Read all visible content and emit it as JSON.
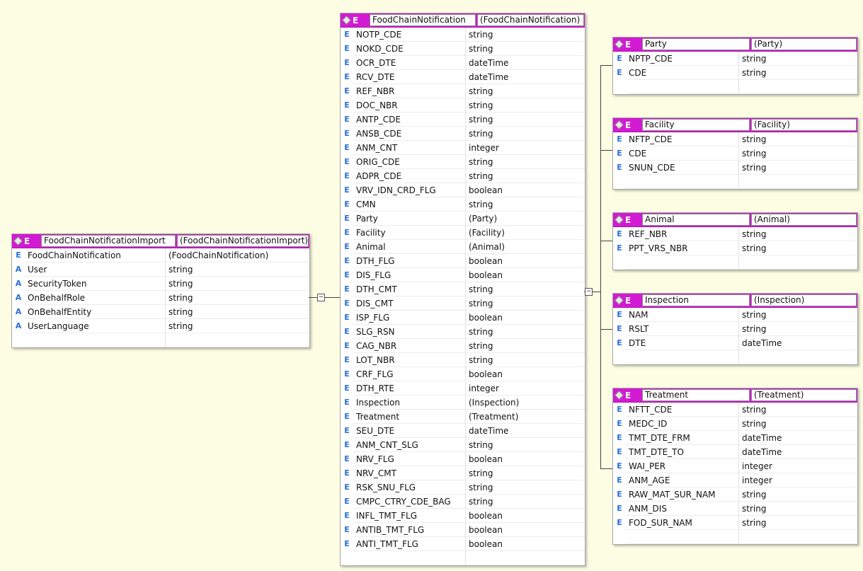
{
  "tables": [
    {
      "id": "import",
      "name": "FoodChainNotificationImport",
      "type": "(FoodChainNotificationImport)",
      "rows": [
        {
          "kind": "E",
          "name": "FoodChainNotification",
          "type": "(FoodChainNotification)"
        },
        {
          "kind": "A",
          "name": "User",
          "type": "string"
        },
        {
          "kind": "A",
          "name": "SecurityToken",
          "type": "string"
        },
        {
          "kind": "A",
          "name": "OnBehalfRole",
          "type": "string"
        },
        {
          "kind": "A",
          "name": "OnBehalfEntity",
          "type": "string"
        },
        {
          "kind": "A",
          "name": "UserLanguage",
          "type": "string"
        }
      ]
    },
    {
      "id": "notification",
      "name": "FoodChainNotification",
      "type": "(FoodChainNotification)",
      "rows": [
        {
          "kind": "E",
          "name": "NOTP_CDE",
          "type": "string"
        },
        {
          "kind": "E",
          "name": "NOKD_CDE",
          "type": "string"
        },
        {
          "kind": "E",
          "name": "OCR_DTE",
          "type": "dateTime"
        },
        {
          "kind": "E",
          "name": "RCV_DTE",
          "type": "dateTime"
        },
        {
          "kind": "E",
          "name": "REF_NBR",
          "type": "string"
        },
        {
          "kind": "E",
          "name": "DOC_NBR",
          "type": "string"
        },
        {
          "kind": "E",
          "name": "ANTP_CDE",
          "type": "string"
        },
        {
          "kind": "E",
          "name": "ANSB_CDE",
          "type": "string"
        },
        {
          "kind": "E",
          "name": "ANM_CNT",
          "type": "integer"
        },
        {
          "kind": "E",
          "name": "ORIG_CDE",
          "type": "string"
        },
        {
          "kind": "E",
          "name": "ADPR_CDE",
          "type": "string"
        },
        {
          "kind": "E",
          "name": "VRV_IDN_CRD_FLG",
          "type": "boolean"
        },
        {
          "kind": "E",
          "name": "CMN",
          "type": "string"
        },
        {
          "kind": "E",
          "name": "Party",
          "type": "(Party)"
        },
        {
          "kind": "E",
          "name": "Facility",
          "type": "(Facility)"
        },
        {
          "kind": "E",
          "name": "Animal",
          "type": "(Animal)"
        },
        {
          "kind": "E",
          "name": "DTH_FLG",
          "type": "boolean"
        },
        {
          "kind": "E",
          "name": "DIS_FLG",
          "type": "boolean"
        },
        {
          "kind": "E",
          "name": "DTH_CMT",
          "type": "string"
        },
        {
          "kind": "E",
          "name": "DIS_CMT",
          "type": "string"
        },
        {
          "kind": "E",
          "name": "ISP_FLG",
          "type": "boolean"
        },
        {
          "kind": "E",
          "name": "SLG_RSN",
          "type": "string"
        },
        {
          "kind": "E",
          "name": "CAG_NBR",
          "type": "string"
        },
        {
          "kind": "E",
          "name": "LOT_NBR",
          "type": "string"
        },
        {
          "kind": "E",
          "name": "CRF_FLG",
          "type": "boolean"
        },
        {
          "kind": "E",
          "name": "DTH_RTE",
          "type": "integer"
        },
        {
          "kind": "E",
          "name": "Inspection",
          "type": "(Inspection)"
        },
        {
          "kind": "E",
          "name": "Treatment",
          "type": "(Treatment)"
        },
        {
          "kind": "E",
          "name": "SEU_DTE",
          "type": "dateTime"
        },
        {
          "kind": "E",
          "name": "ANM_CNT_SLG",
          "type": "string"
        },
        {
          "kind": "E",
          "name": "NRV_FLG",
          "type": "boolean"
        },
        {
          "kind": "E",
          "name": "NRV_CMT",
          "type": "string"
        },
        {
          "kind": "E",
          "name": "RSK_SNU_FLG",
          "type": "string"
        },
        {
          "kind": "E",
          "name": "CMPC_CTRY_CDE_BAG",
          "type": "string"
        },
        {
          "kind": "E",
          "name": "INFL_TMT_FLG",
          "type": "boolean"
        },
        {
          "kind": "E",
          "name": "ANTIB_TMT_FLG",
          "type": "boolean"
        },
        {
          "kind": "E",
          "name": "ANTI_TMT_FLG",
          "type": "boolean"
        }
      ]
    },
    {
      "id": "party",
      "name": "Party",
      "type": "(Party)",
      "rows": [
        {
          "kind": "E",
          "name": "NPTP_CDE",
          "type": "string"
        },
        {
          "kind": "E",
          "name": "CDE",
          "type": "string"
        }
      ]
    },
    {
      "id": "facility",
      "name": "Facility",
      "type": "(Facility)",
      "rows": [
        {
          "kind": "E",
          "name": "NFTP_CDE",
          "type": "string"
        },
        {
          "kind": "E",
          "name": "CDE",
          "type": "string"
        },
        {
          "kind": "E",
          "name": "SNUN_CDE",
          "type": "string"
        }
      ]
    },
    {
      "id": "animal",
      "name": "Animal",
      "type": "(Animal)",
      "rows": [
        {
          "kind": "E",
          "name": "REF_NBR",
          "type": "string"
        },
        {
          "kind": "E",
          "name": "PPT_VRS_NBR",
          "type": "string"
        }
      ]
    },
    {
      "id": "inspection",
      "name": "Inspection",
      "type": "(Inspection)",
      "rows": [
        {
          "kind": "E",
          "name": "NAM",
          "type": "string"
        },
        {
          "kind": "E",
          "name": "RSLT",
          "type": "string"
        },
        {
          "kind": "E",
          "name": "DTE",
          "type": "dateTime"
        }
      ]
    },
    {
      "id": "treatment",
      "name": "Treatment",
      "type": "(Treatment)",
      "rows": [
        {
          "kind": "E",
          "name": "NFTT_CDE",
          "type": "string"
        },
        {
          "kind": "E",
          "name": "MEDC_ID",
          "type": "string"
        },
        {
          "kind": "E",
          "name": "TMT_DTE_FRM",
          "type": "dateTime"
        },
        {
          "kind": "E",
          "name": "TMT_DTE_TO",
          "type": "dateTime"
        },
        {
          "kind": "E",
          "name": "WAI_PER",
          "type": "integer"
        },
        {
          "kind": "E",
          "name": "ANM_AGE",
          "type": "integer"
        },
        {
          "kind": "E",
          "name": "RAW_MAT_SUR_NAM",
          "type": "string"
        },
        {
          "kind": "E",
          "name": "ANM_DIS",
          "type": "string"
        },
        {
          "kind": "E",
          "name": "FOD_SUR_NAM",
          "type": "string"
        }
      ]
    }
  ],
  "header_tag": "E",
  "collapse_glyph": "−"
}
